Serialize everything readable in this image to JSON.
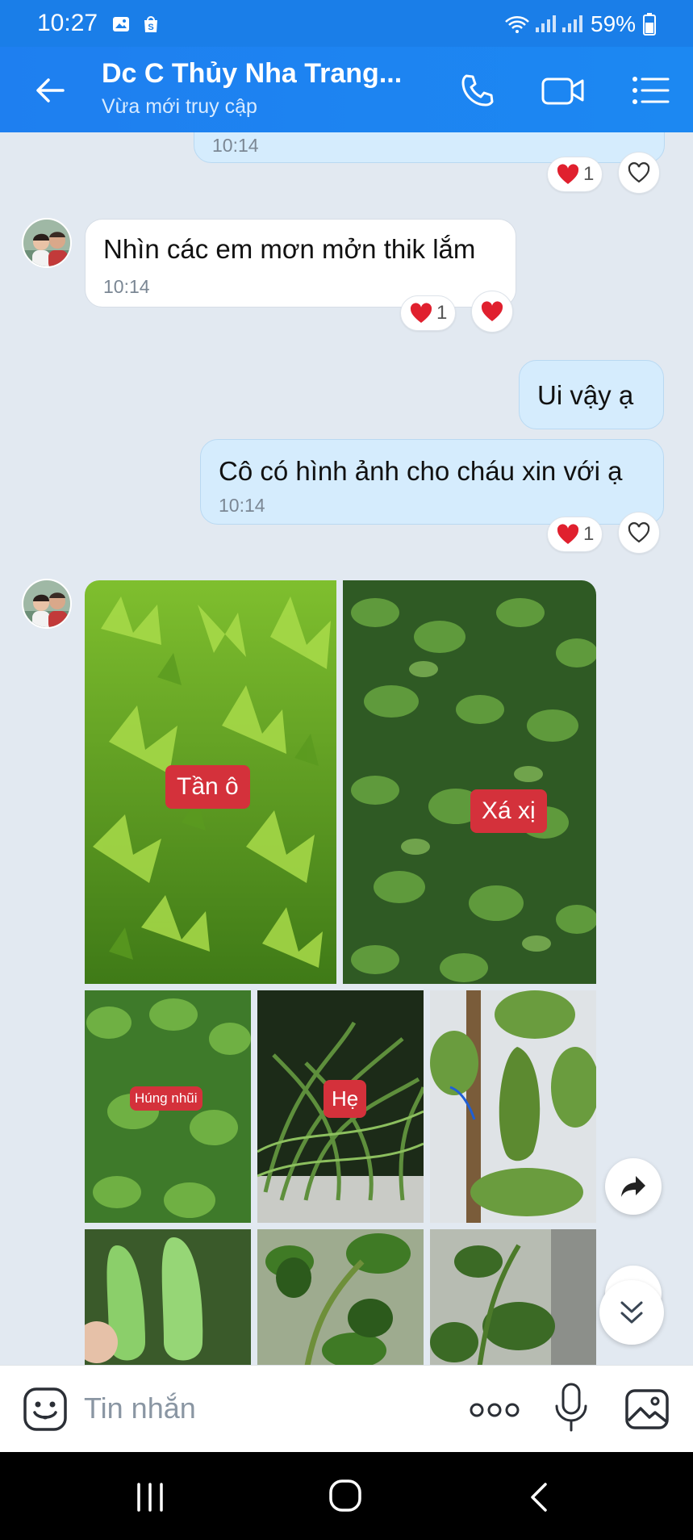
{
  "status_bar": {
    "time": "10:27",
    "battery": "59%"
  },
  "header": {
    "title": "Dc C Thủy Nha Trang...",
    "subtitle": "Vừa mới truy cập"
  },
  "messages": [
    {
      "time": "10:14",
      "reaction_count": "1"
    },
    {
      "text": "Nhìn các em mơn mởn thik lắm",
      "time": "10:14",
      "reaction_count": "1"
    },
    {
      "text": "Ui vậy ạ"
    },
    {
      "text": "Cô có hình ảnh cho cháu xin với ạ",
      "time": "10:14",
      "reaction_count": "1"
    }
  ],
  "photos": {
    "labels": [
      "Tần ô",
      "Xá xị",
      "Húng nhũi",
      "Hẹ"
    ]
  },
  "input": {
    "placeholder": "Tin nhắn"
  },
  "colors": {
    "header": "#1e7ff0",
    "bubble_out": "#d5ecfd",
    "heart": "#e0202e",
    "label": "#d4313b"
  }
}
